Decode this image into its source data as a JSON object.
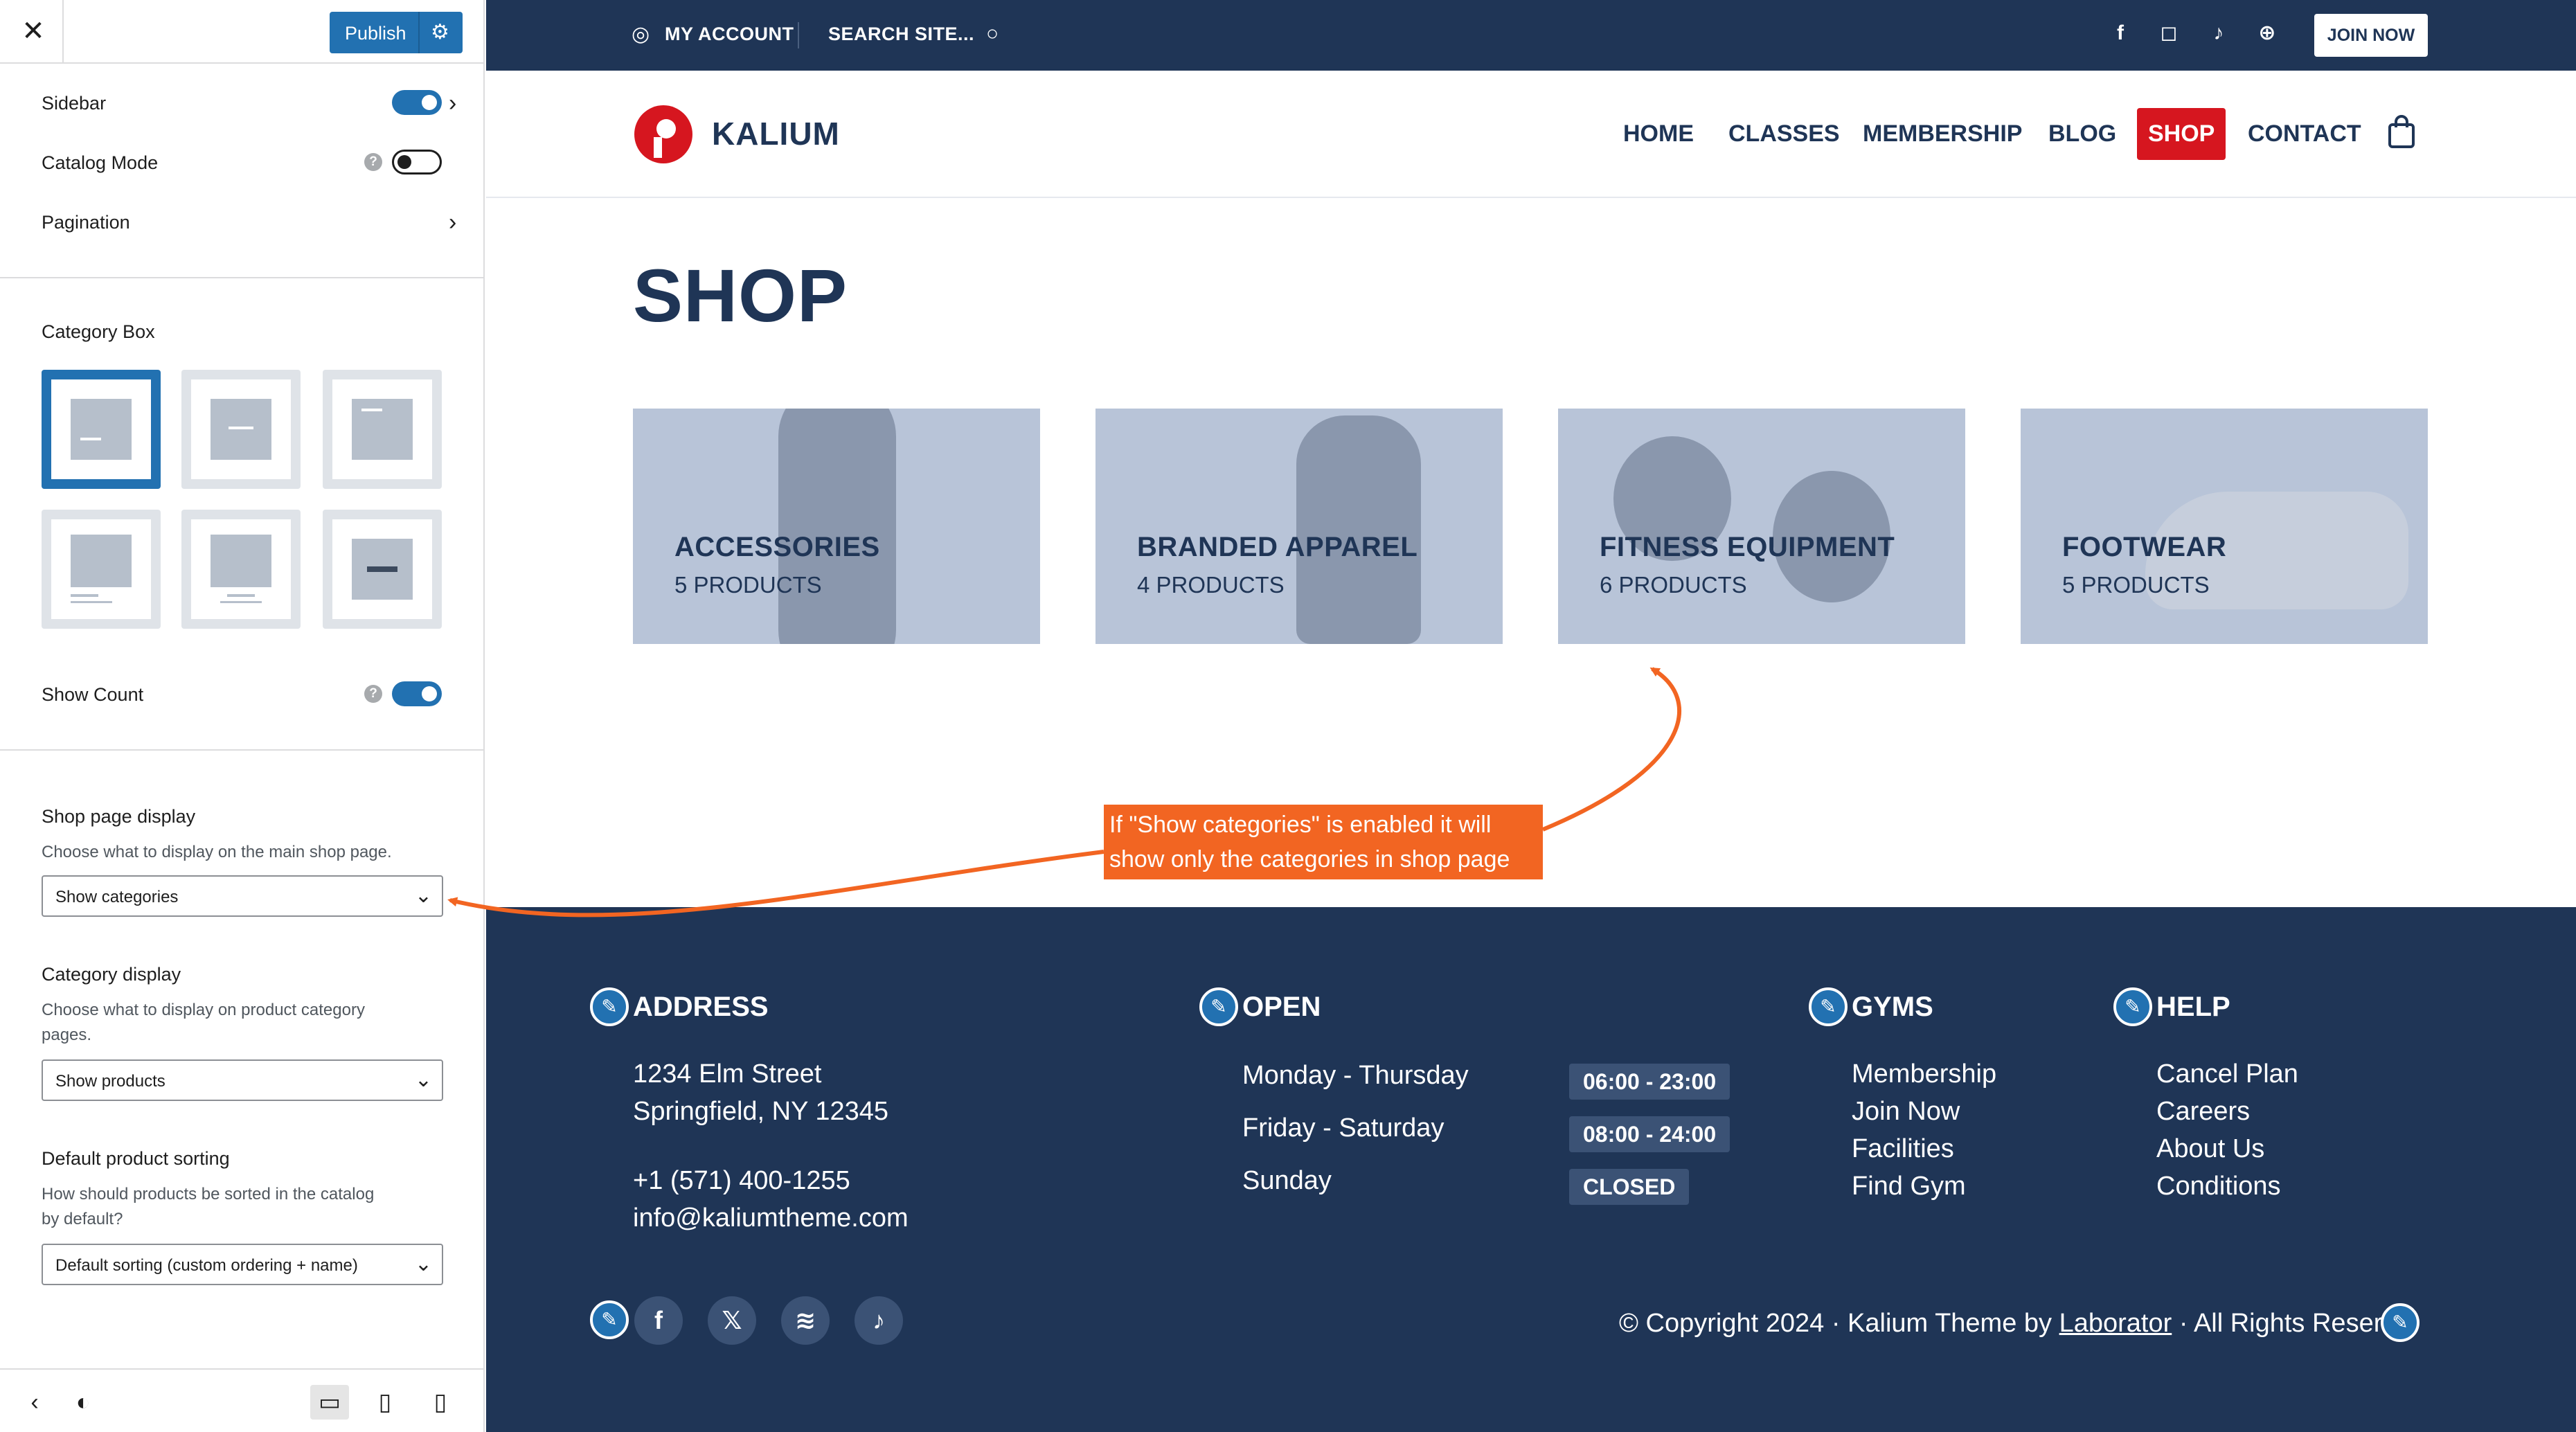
{
  "customizer": {
    "close_icon": "close-icon",
    "publish_label": "Publish",
    "settings_icon": "gear-icon",
    "rows": [
      {
        "label": "Sidebar",
        "toggle": true,
        "chevron": true
      },
      {
        "label": "Catalog Mode",
        "toggle": false,
        "help": true
      },
      {
        "label": "Pagination",
        "chevron": true
      }
    ],
    "category_box_title": "Category Box",
    "show_count_label": "Show Count",
    "show_count": true,
    "shop_page_display": {
      "title": "Shop page display",
      "description": "Choose what to display on the main shop page.",
      "value": "Show categories"
    },
    "category_display": {
      "title": "Category display",
      "description_line1": "Choose what to display on product category",
      "description_line2": "pages.",
      "value": "Show products"
    },
    "default_sorting": {
      "title": "Default product sorting",
      "description_line1": "How should products be sorted in the catalog",
      "description_line2": "by default?",
      "value": "Default sorting (custom ordering + name)"
    },
    "footer_icons": [
      "back-icon",
      "contrast-icon",
      "desktop-icon",
      "tablet-icon",
      "mobile-icon"
    ],
    "accent_color": "#2271b1"
  },
  "site": {
    "topbar": {
      "my_account": "MY ACCOUNT",
      "search": "SEARCH SITE...",
      "join_now": "JOIN NOW",
      "social_icons": [
        "facebook-icon",
        "instagram-icon",
        "tiktok-icon",
        "globe-icon"
      ]
    },
    "logo_text": "KALIUM",
    "nav": [
      "HOME",
      "CLASSES",
      "MEMBERSHIP",
      "BLOG",
      "SHOP",
      "CONTACT"
    ],
    "active_nav": "SHOP",
    "page_title": "SHOP",
    "categories": [
      {
        "name": "ACCESSORIES",
        "count": "5 PRODUCTS"
      },
      {
        "name": "BRANDED APPAREL",
        "count": "4 PRODUCTS"
      },
      {
        "name": "FITNESS EQUIPMENT",
        "count": "6 PRODUCTS"
      },
      {
        "name": "FOOTWEAR",
        "count": "5 PRODUCTS"
      }
    ],
    "annotation": {
      "line1": "If \"Show categories\" is enabled it will",
      "line2": "show only the categories in shop page"
    },
    "footer": {
      "address_title": "ADDRESS",
      "address_line1": "1234 Elm Street",
      "address_line2": "Springfield, NY 12345",
      "phone": "+1 (571) 400-1255",
      "email": "info@kaliumtheme.com",
      "open_title": "OPEN",
      "hours": [
        {
          "day": "Monday - Thursday",
          "time": "06:00 - 23:00"
        },
        {
          "day": "Friday - Saturday",
          "time": "08:00 - 24:00"
        },
        {
          "day": "Sunday",
          "time": "CLOSED"
        }
      ],
      "gyms_title": "GYMS",
      "gyms_links": [
        "Membership",
        "Join Now",
        "Facilities",
        "Find Gym"
      ],
      "help_title": "HELP",
      "help_links": [
        "Cancel Plan",
        "Careers",
        "About Us",
        "Conditions"
      ],
      "copyright_prefix": "© Copyright 2024 · Kalium Theme by ",
      "copyright_link": "Laborator",
      "copyright_suffix": " · All Rights Reser",
      "social_icons": [
        "facebook-icon",
        "x-icon",
        "spotify-icon",
        "tiktok-icon"
      ]
    },
    "colors": {
      "navy": "#1f3556",
      "red": "#d6161f",
      "annotation": "#f26522"
    }
  }
}
